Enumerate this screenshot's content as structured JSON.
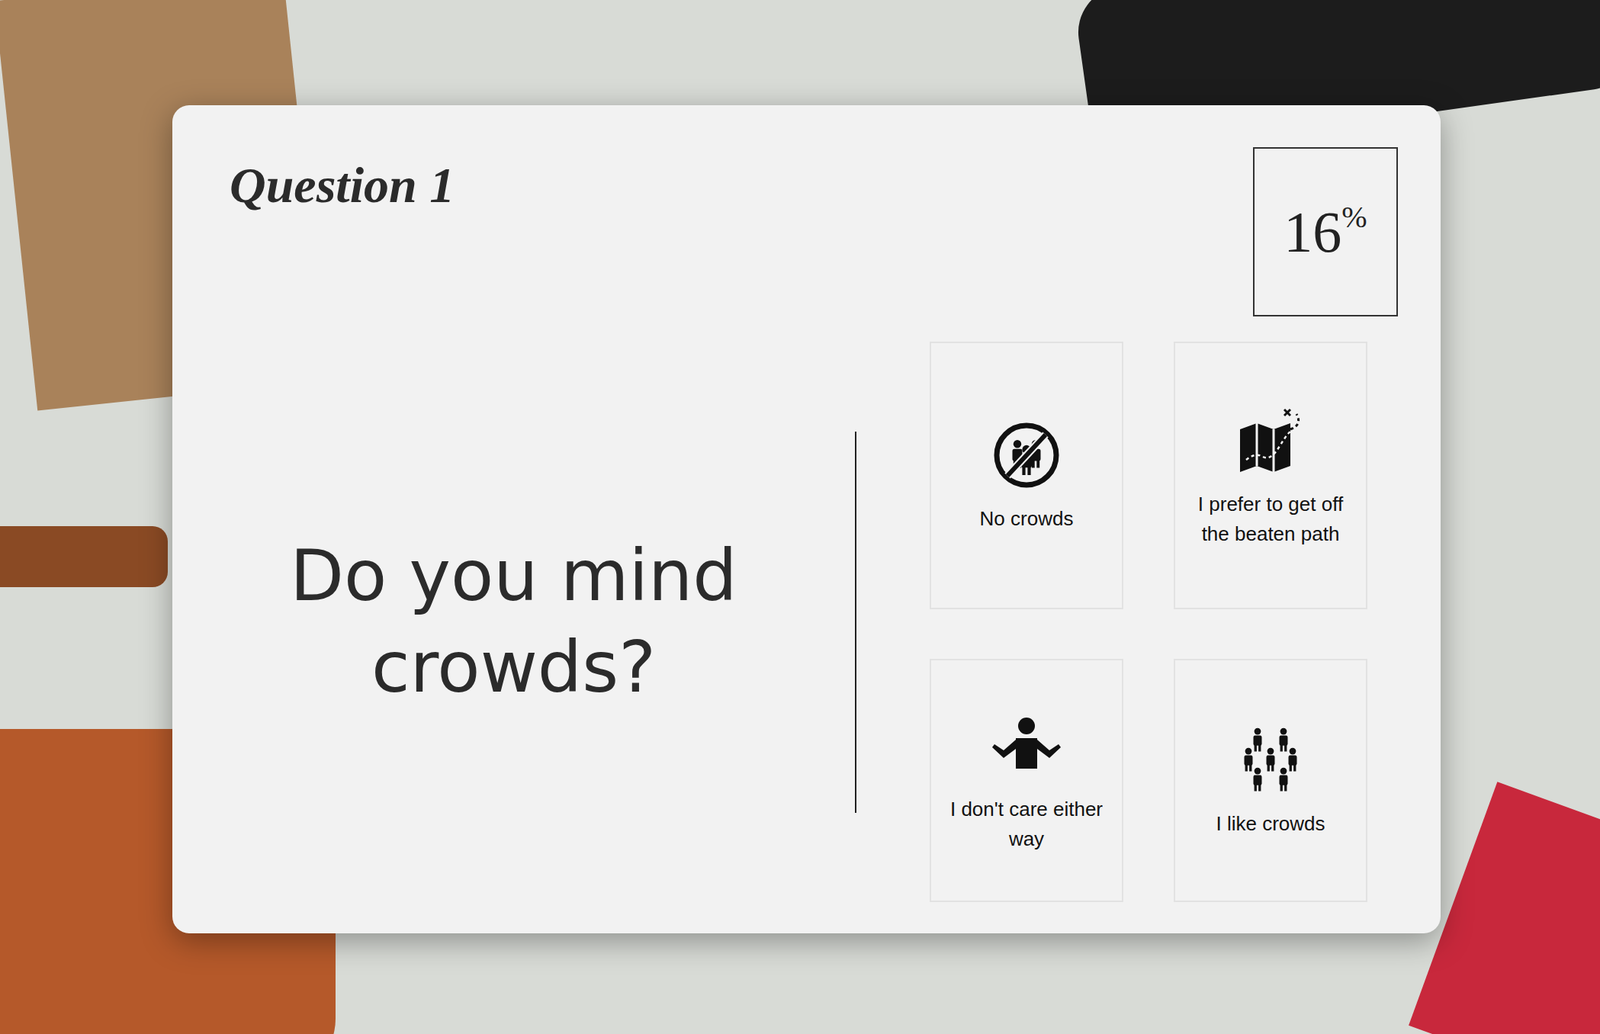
{
  "question": {
    "number_label": "Question 1",
    "text": "Do you mind crowds?"
  },
  "progress": {
    "value": "16",
    "unit": "%"
  },
  "options": [
    {
      "label": "No crowds",
      "selected": false
    },
    {
      "label": "I prefer to get off the beaten path",
      "selected": false
    },
    {
      "label": "I don't care either way",
      "selected": false
    },
    {
      "label": "I like crowds",
      "selected": false
    }
  ]
}
